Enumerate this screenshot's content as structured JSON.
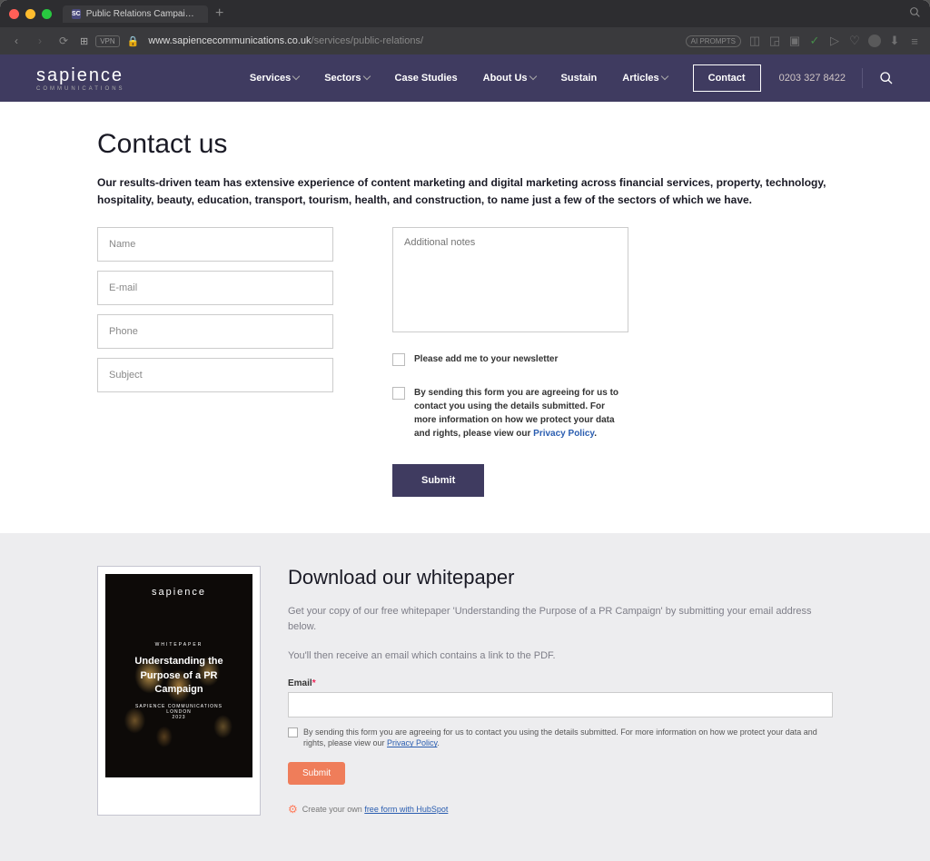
{
  "browser": {
    "tab_title": "Public Relations Campaigns & I",
    "tab_favicon_text": "SC",
    "url_domain": "www.sapiencecommunications.co.uk",
    "url_path": "/services/public-relations/",
    "ai_badge": "AI PROMPTS"
  },
  "header": {
    "logo_main": "sapience",
    "logo_sub": "COMMUNICATIONS",
    "nav": [
      {
        "label": "Services",
        "dropdown": true
      },
      {
        "label": "Sectors",
        "dropdown": true
      },
      {
        "label": "Case Studies",
        "dropdown": false
      },
      {
        "label": "About Us",
        "dropdown": true
      },
      {
        "label": "Sustain",
        "dropdown": false
      },
      {
        "label": "Articles",
        "dropdown": true
      }
    ],
    "contact_label": "Contact",
    "phone": "0203 327 8422"
  },
  "contact": {
    "title": "Contact us",
    "description": "Our results-driven team has extensive experience of content marketing and digital marketing across financial services, property, technology, hospitality, beauty, education, transport, tourism, health, and construction, to name just a few of the sectors of which we have.",
    "fields": {
      "name_ph": "Name",
      "email_ph": "E-mail",
      "phone_ph": "Phone",
      "subject_ph": "Subject",
      "notes_ph": "Additional notes"
    },
    "newsletter_label": "Please add me to your newsletter",
    "consent_text": "By sending this form you are agreeing for us to contact you using the details submitted. For more information on how we protect your data and rights, please view our ",
    "privacy_link": "Privacy Policy",
    "submit_label": "Submit"
  },
  "whitepaper": {
    "title": "Download our whitepaper",
    "text1": "Get your copy of our free whitepaper 'Understanding the Purpose of a PR Campaign' by submitting your email address below.",
    "text2": "You'll then receive an email which contains a link to the PDF.",
    "email_label": "Email",
    "consent": "By sending this form you are agreeing for us to contact you using the details submitted. For more information on how we protect your data and rights, please view our ",
    "privacy_link": "Privacy Policy",
    "submit_label": "Submit",
    "hubspot_text": "Create your own ",
    "hubspot_link": "free form with HubSpot",
    "image": {
      "logo": "sapience",
      "type": "WHITEPAPER",
      "headline": "Understanding the Purpose of a PR Campaign",
      "footer1": "SAPIENCE COMMUNICATIONS",
      "footer2": "LONDON",
      "footer3": "2023"
    }
  }
}
